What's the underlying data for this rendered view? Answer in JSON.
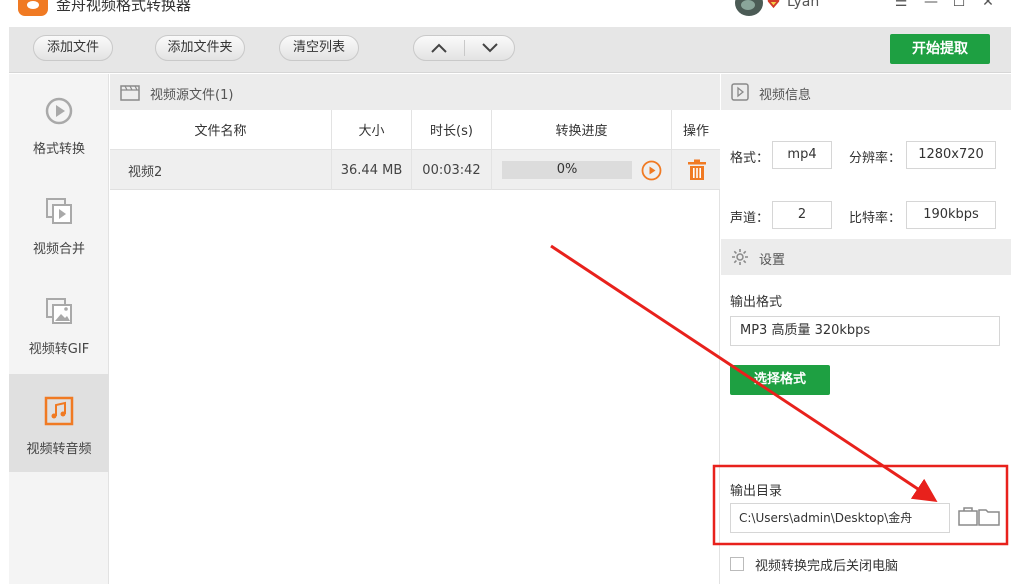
{
  "window": {
    "title": "金舟视频格式转换器",
    "user_name": "Lyan"
  },
  "toolbar": {
    "add_file": "添加文件",
    "add_folder": "添加文件夹",
    "clear_list": "清空列表",
    "start": "开始提取"
  },
  "sidebar": {
    "items": [
      {
        "label": "格式转换",
        "icon": "format-convert-icon",
        "active": false
      },
      {
        "label": "视频合并",
        "icon": "video-merge-icon",
        "active": false
      },
      {
        "label": "视频转GIF",
        "icon": "video-to-gif-icon",
        "active": false
      },
      {
        "label": "视频转音频",
        "icon": "video-to-audio-icon",
        "active": true
      }
    ]
  },
  "file_panel": {
    "title": "视频源文件(1)",
    "columns": [
      "文件名称",
      "大小",
      "时长(s)",
      "转换进度",
      "操作"
    ],
    "rows": [
      {
        "name": "视频2",
        "size": "36.44 MB",
        "duration": "00:03:42",
        "progress_text": "0%",
        "progress": 0
      }
    ]
  },
  "video_info": {
    "title": "视频信息",
    "format_label": "格式：",
    "format": "mp4",
    "resolution_label": "分辨率：",
    "resolution": "1280x720",
    "channels_label": "声道：",
    "channels": "2",
    "bitrate_label": "比特率：",
    "bitrate": "190kbps"
  },
  "settings": {
    "title": "设置",
    "output_format_label": "输出格式",
    "output_format": "MP3 高质量 320kbps",
    "choose_format": "选择格式",
    "output_dir_label": "输出目录",
    "output_dir": "C:\\Users\\admin\\Desktop\\金舟",
    "shutdown_label": "视频转换完成后关闭电脑",
    "shutdown_checked": false
  },
  "colors": {
    "accent_green": "#1ea042",
    "accent_orange": "#f07a23",
    "annotation_red": "#e8211c"
  }
}
